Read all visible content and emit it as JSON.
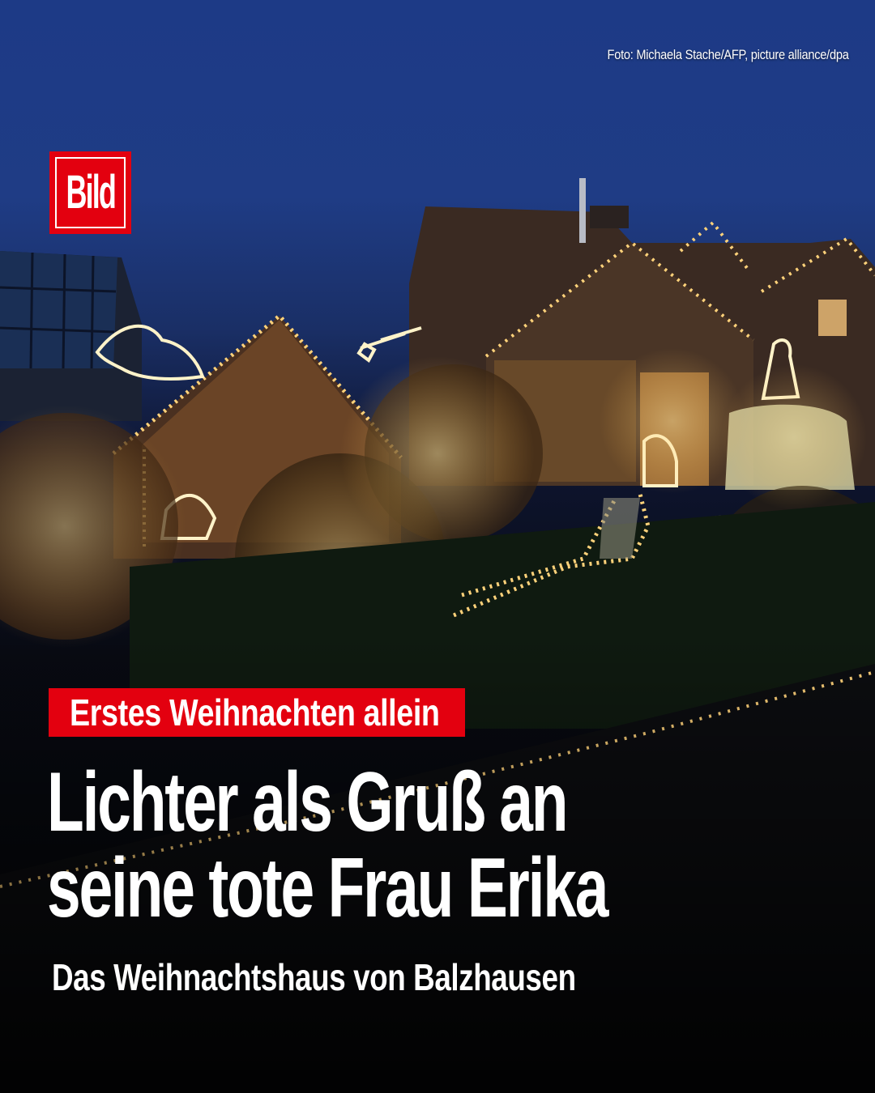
{
  "credit": "Foto: Michaela Stache/AFP, picture alliance/dpa",
  "logo": {
    "text": "Bild",
    "color": "#e3000f"
  },
  "overline": "Erstes Weihnachten allein",
  "headline": {
    "line1": "Lichter als Gruß an",
    "line2": "seine tote Frau Erika"
  },
  "subline": "Das Weihnachtshaus von Balzhausen",
  "colors": {
    "accent": "#e3000f",
    "sky": "#1f3c85",
    "lights": "#ffd27a"
  }
}
